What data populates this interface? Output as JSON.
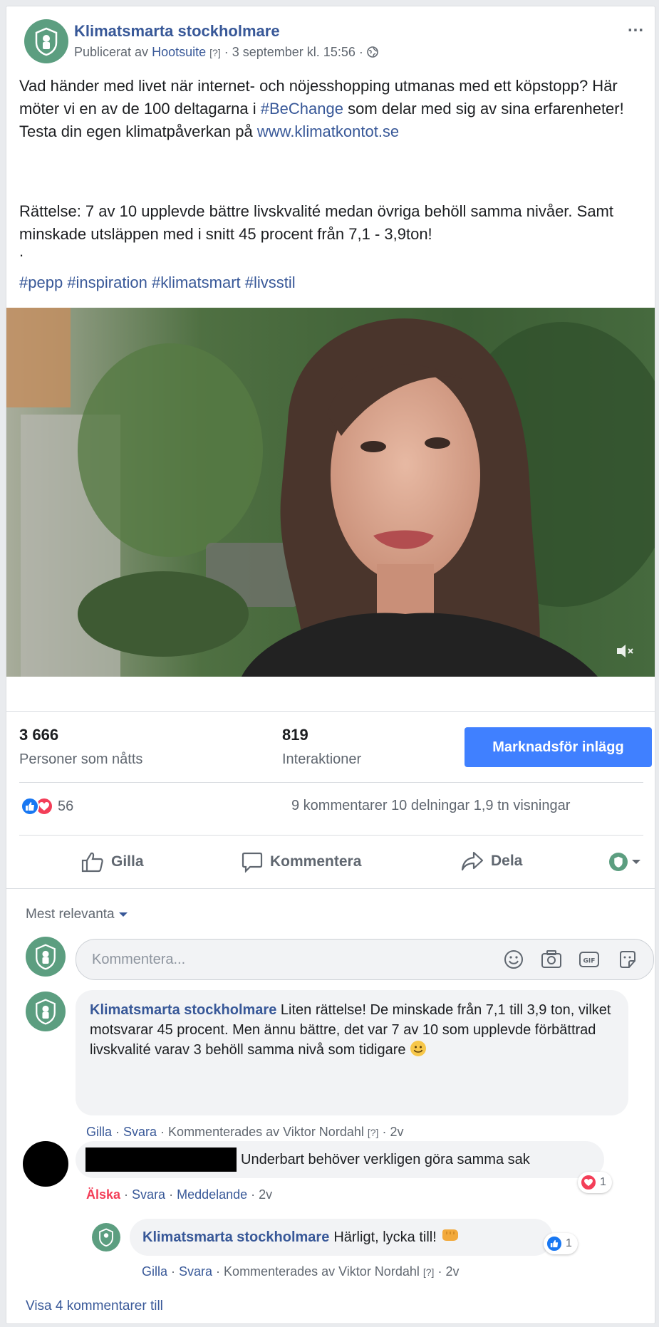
{
  "page": {
    "name": "Klimatsmarta stockholmare"
  },
  "header": {
    "published_by_prefix": "Publicerat av",
    "published_by": "Hootsuite",
    "help_marker": "[?]",
    "separator": "·",
    "date": "3 september kl. 15:56",
    "more_label": "..."
  },
  "post": {
    "text_1": "Vad händer med livet när internet- och nöjesshopping utmanas med ett köpstopp? Här möter vi en av de 100 deltagarna i ",
    "hashtag_bechange": "#BeChange",
    "text_2": " som delar med sig av sina erfarenheter! Testa din egen klimatpåverkan på ",
    "url": "www.klimatkontot.se",
    "correction": "Rättelse: 7 av 10 upplevde bättre livskvalité medan övriga behöll samma nivåer. Samt minskade utsläppen med i snitt 45 procent från 7,1 - 3,9ton!",
    "dot": ".",
    "hashtags": [
      "#pepp",
      "#inspiration",
      "#klimatsmart",
      "#livsstil"
    ]
  },
  "insights": {
    "reach_value": "3 666",
    "reach_label": "Personer som nåtts",
    "interactions_value": "819",
    "interactions_label": "Interaktioner",
    "promote_label": "Marknadsför inlägg"
  },
  "stats": {
    "reactions_count": "56",
    "comments": "9 kommentarer",
    "shares": "10 delningar",
    "views": "1,9 tn visningar"
  },
  "actions": {
    "like": "Gilla",
    "comment": "Kommentera",
    "share": "Dela"
  },
  "comments_section": {
    "sort_label": "Mest relevanta",
    "input_placeholder": "Kommentera...",
    "view_more": "Visa 4 kommentarer till"
  },
  "comments": [
    {
      "author": "Klimatsmarta stockholmare",
      "text": "Liten rättelse! De minskade från 7,1 till 3,9 ton, vilket motsvarar 45 procent. Men ännu bättre, det var 7 av 10 som upplevde förbättrad livskvalité varav 3 behöll samma nivå som tidigare",
      "like": "Gilla",
      "reply": "Svara",
      "commented_by": "Kommenterades av Viktor Nordahl",
      "help": "[?]",
      "age": "2v"
    },
    {
      "author": "",
      "text": "Underbart behöver verkligen göra samma sak",
      "love": "Älska",
      "reply": "Svara",
      "message": "Meddelande",
      "age": "2v",
      "reaction_count": "1"
    }
  ],
  "reply": {
    "author": "Klimatsmarta stockholmare",
    "text": "Härligt, lycka till!",
    "reaction_count": "1",
    "like": "Gilla",
    "reply": "Svara",
    "commented_by": "Kommenterades av Viktor Nordahl",
    "help": "[?]",
    "age": "2v"
  },
  "colors": {
    "brand": "#385898",
    "promote_button": "#4080ff",
    "love": "#f33e58",
    "like": "#1877f2",
    "avatar": "#5c9e80"
  }
}
